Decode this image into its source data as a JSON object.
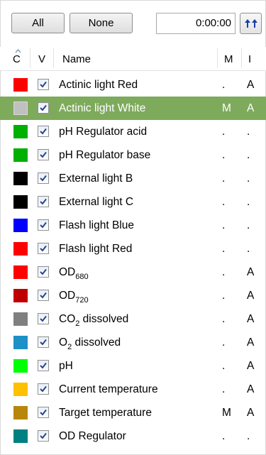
{
  "toolbar": {
    "all_label": "All",
    "none_label": "None",
    "time_value": "0:00:00",
    "sort_icon": "double-up-arrow-icon"
  },
  "header": {
    "c": "C",
    "v": "V",
    "name": "Name",
    "m": "M",
    "i": "I"
  },
  "rows": [
    {
      "color": "#ff0000",
      "checked": true,
      "name": "Actinic light Red",
      "m": ".",
      "i": "A"
    },
    {
      "color": "#c0c0c0",
      "checked": true,
      "name": "Actinic light White",
      "m": "M",
      "i": "A",
      "selected": true
    },
    {
      "color": "#00b000",
      "checked": true,
      "name": "pH Regulator acid",
      "m": ".",
      "i": "."
    },
    {
      "color": "#00b000",
      "checked": true,
      "name": "pH Regulator base",
      "m": ".",
      "i": "."
    },
    {
      "color": "#000000",
      "checked": true,
      "name": "External light B",
      "m": ".",
      "i": "."
    },
    {
      "color": "#000000",
      "checked": true,
      "name": "External light C",
      "m": ".",
      "i": "."
    },
    {
      "color": "#0000ff",
      "checked": true,
      "name": "Flash light Blue",
      "m": ".",
      "i": "."
    },
    {
      "color": "#ff0000",
      "checked": true,
      "name": "Flash light Red",
      "m": ".",
      "i": "."
    },
    {
      "color": "#ff0000",
      "checked": true,
      "name_main": "OD",
      "name_sub": "680",
      "m": ".",
      "i": "A"
    },
    {
      "color": "#c00000",
      "checked": true,
      "name_main": "OD",
      "name_sub": "720",
      "m": ".",
      "i": "A"
    },
    {
      "color": "#808080",
      "checked": true,
      "name_main": "CO",
      "name_sub": "2",
      "name_rest": " dissolved",
      "m": ".",
      "i": "A"
    },
    {
      "color": "#1e90c8",
      "checked": true,
      "name_main": "O",
      "name_sub": "2",
      "name_rest": " dissolved",
      "m": ".",
      "i": "A"
    },
    {
      "color": "#00ff00",
      "checked": true,
      "name": "pH",
      "m": ".",
      "i": "A"
    },
    {
      "color": "#ffc000",
      "checked": true,
      "name": "Current temperature",
      "m": ".",
      "i": "A"
    },
    {
      "color": "#b8860b",
      "checked": true,
      "name": "Target temperature",
      "m": "M",
      "i": "A"
    },
    {
      "color": "#008080",
      "checked": true,
      "name": "OD Regulator",
      "m": ".",
      "i": "."
    }
  ]
}
